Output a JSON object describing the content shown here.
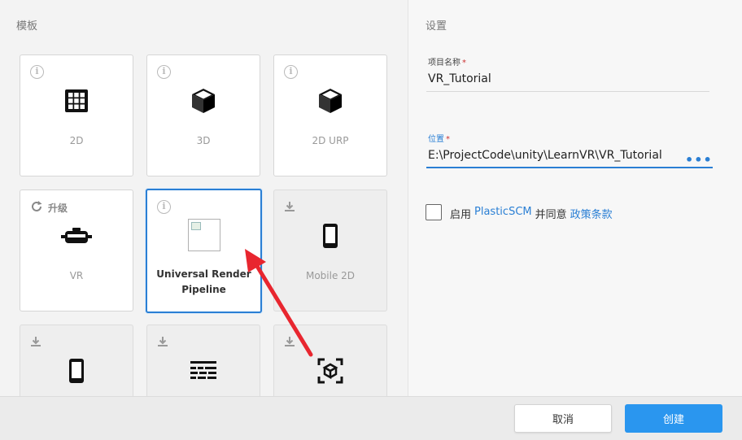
{
  "templates": {
    "title": "模板",
    "cards": [
      {
        "label": "2D",
        "icon": "grid-icon",
        "badge": "info",
        "state": "normal"
      },
      {
        "label": "3D",
        "icon": "cube-icon",
        "badge": "info",
        "state": "normal"
      },
      {
        "label": "2D URP",
        "icon": "cube-icon",
        "badge": "info",
        "state": "normal"
      },
      {
        "label": "VR",
        "icon": "vr-headset-icon",
        "badge": "upgrade",
        "badge_label": "升级",
        "state": "normal"
      },
      {
        "label": "Universal Render Pipeline",
        "icon": "broken-image-icon",
        "badge": "info",
        "state": "selected"
      },
      {
        "label": "Mobile 2D",
        "icon": "phone-icon",
        "badge": "download",
        "state": "download"
      },
      {
        "label": "",
        "icon": "phone-icon",
        "badge": "download",
        "state": "download"
      },
      {
        "label": "",
        "icon": "text-layout-icon",
        "badge": "download",
        "state": "download"
      },
      {
        "label": "",
        "icon": "ar-cube-icon",
        "badge": "download",
        "state": "download"
      }
    ]
  },
  "settings": {
    "title": "设置",
    "project_name_label": "项目名称",
    "project_name_value": "VR_Tutorial",
    "location_label": "位置",
    "location_value": "E:\\ProjectCode\\unity\\LearnVR\\VR_Tutorial",
    "location_more": "•••",
    "required_mark": "*",
    "consent_prefix": "启用",
    "consent_plastic": "PlasticSCM",
    "consent_mid": "并同意",
    "consent_policy": "政策条款",
    "consent_checked": false
  },
  "footer": {
    "cancel_label": "取消",
    "create_label": "创建"
  },
  "colors": {
    "accent": "#2a7fd4",
    "create_button": "#2a96ef",
    "annotation_arrow": "#e8262f"
  }
}
